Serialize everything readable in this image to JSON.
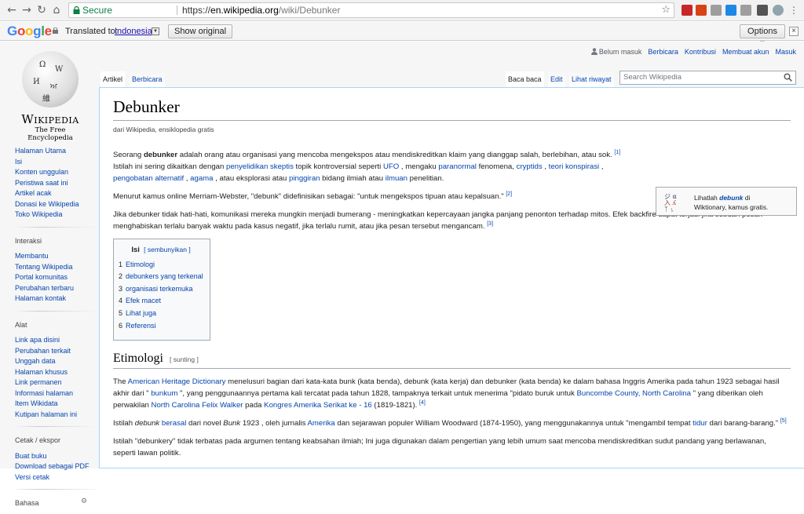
{
  "browser": {
    "secure_label": "Secure",
    "url_scheme": "https://",
    "url_host": "en.wikipedia.org",
    "url_path": "/wiki/Debunker"
  },
  "translate_bar": {
    "logo": "Google",
    "translated_to": "Translated to:",
    "language": "Indonesian",
    "show_original": "Show original",
    "options": "Options ▼"
  },
  "wiki": {
    "wordmark": "Wikipedia",
    "tagline": "The Free Encyclopedia",
    "personal": [
      "Belum masuk",
      "Berbicara",
      "Kontribusi",
      "Membuat akun",
      "Masuk"
    ],
    "tabs_left": [
      "Artikel",
      "Berbicara"
    ],
    "tabs_right": [
      "Baca baca",
      "Edit",
      "Lihat riwayat"
    ],
    "search_placeholder": "Search Wikipedia",
    "sidebar": {
      "main": [
        "Halaman Utama",
        "Isi",
        "Konten unggulan",
        "Peristiwa saat ini",
        "Artikel acak",
        "Donasi ke Wikipedia",
        "Toko Wikipedia"
      ],
      "interaksi_head": "Interaksi",
      "interaksi": [
        "Membantu",
        "Tentang Wikipedia",
        "Portal komunitas",
        "Perubahan terbaru",
        "Halaman kontak"
      ],
      "alat_head": "Alat",
      "alat": [
        "Link apa disini",
        "Perubahan terkait",
        "Unggah data",
        "Halaman khusus",
        "Link permanen",
        "Informasi halaman",
        "Item Wikidata",
        "Kutipan halaman ini"
      ],
      "cetak_head": "Cetak / ekspor",
      "cetak": [
        "Buat buku",
        "Download sebagai PDF",
        "Versi cetak"
      ],
      "bahasa_head": "Bahasa"
    },
    "article": {
      "title": "Debunker",
      "subtitle": "dari Wikipedia, ensiklopedia gratis",
      "wiktionary": {
        "pre": "Lihatlah ",
        "word": "debunk",
        "post": " di",
        "line2": "Wiktionary, kamus gratis."
      },
      "p1": {
        "t1": "Seorang ",
        "b1": "debunker",
        "t2": " adalah orang atau organisasi yang mencoba mengekspos atau mendiskreditkan klaim yang dianggap salah, berlebihan, atau sok. ",
        "r1": "[1]",
        "t3": "Istilah ini sering dikaitkan dengan ",
        "l1": "penyelidikan skeptis",
        "t4": " topik kontroversial seperti ",
        "l2": "UFO",
        "t5": " , mengaku ",
        "l3": "paranormal",
        "t6": " fenomena, ",
        "l4": "cryptids",
        "t7": " , ",
        "l5": "teori konspirasi",
        "t8": " ,",
        "l6": "pengobatan alternatif",
        "t9": " , ",
        "l7": "agama",
        "t10": " , atau eksplorasi atau ",
        "l8": "pinggiran",
        "t11": " bidang ilmiah atau ",
        "l9": "ilmuan",
        "t12": " penelitian."
      },
      "p2": {
        "t1": "Menurut kamus online Merriam-Webster, \"debunk\" didefinisikan sebagai: \"untuk mengekspos tipuan atau kepalsuan.\" ",
        "r": "[2]"
      },
      "p3": {
        "t1": "Jika debunker tidak hati-hati, komunikasi mereka mungkin menjadi bumerang - meningkatkan kepercayaan jangka panjang penonton terhadap mitos. Efek backfire dapat terjadi jika sebuah pesan menghabiskan terlalu banyak waktu pada kasus negatif, jika terlalu rumit, atau jika pesan tersebut mengancam. ",
        "r": "[3]"
      },
      "toc": {
        "title": "Isi",
        "toggle": "[ sembunyikan ]",
        "items": [
          {
            "num": "1",
            "label": "Etimologi"
          },
          {
            "num": "2",
            "label": "debunkers yang terkenal"
          },
          {
            "num": "3",
            "label": "organisasi terkemuka"
          },
          {
            "num": "4",
            "label": "Efek macet"
          },
          {
            "num": "5",
            "label": "Lihat juga"
          },
          {
            "num": "6",
            "label": "Referensi"
          }
        ]
      },
      "section1": {
        "title": "Etimologi",
        "edit": "[ sunting ]"
      },
      "p4": {
        "t1": "The ",
        "l1": "American Heritage Dictionary",
        "t2": " menelusuri bagian dari kata-kata bunk (kata benda), debunk (kata kerja) dan debunker (kata benda) ke dalam bahasa Inggris Amerika pada tahun 1923 sebagai hasil akhir dari \" ",
        "l2": "bunkum",
        "t3": " \", yang penggunaannya pertama kali tercatat pada tahun 1828, tampaknya terkait untuk menerima \"pidato buruk untuk ",
        "l3": "Buncombe County, North Carolina",
        "t4": " \" yang diberikan oleh perwakilan ",
        "l4": "North Carolina",
        "t5": " ",
        "l5": "Felix Walker",
        "t6": " pada ",
        "l6": "Kongres Amerika Serikat ke - 16",
        "t7": " (1819-1821). ",
        "r": "[4]"
      },
      "p5": {
        "t1": "Istilah ",
        "i1": "debunk",
        "t2": " ",
        "l1": "berasal",
        "t3": " dari novel ",
        "i2": "Bunk",
        "t4": " 1923 , oleh jurnalis ",
        "l2": "Amerika",
        "t5": " dan sejarawan populer William Woodward (1874-1950), yang menggunakannya untuk \"mengambil tempat ",
        "l3": "tidur",
        "t6": " dari barang-barang.\" ",
        "r": "[5]"
      },
      "p6": {
        "t1": "Istilah \"debunkery\" tidak terbatas pada argumen tentang keabsahan ilmiah; Ini juga digunakan dalam pengertian yang lebih umum saat mencoba mendiskreditkan sudut pandang yang berlawanan, seperti lawan politik."
      }
    }
  }
}
